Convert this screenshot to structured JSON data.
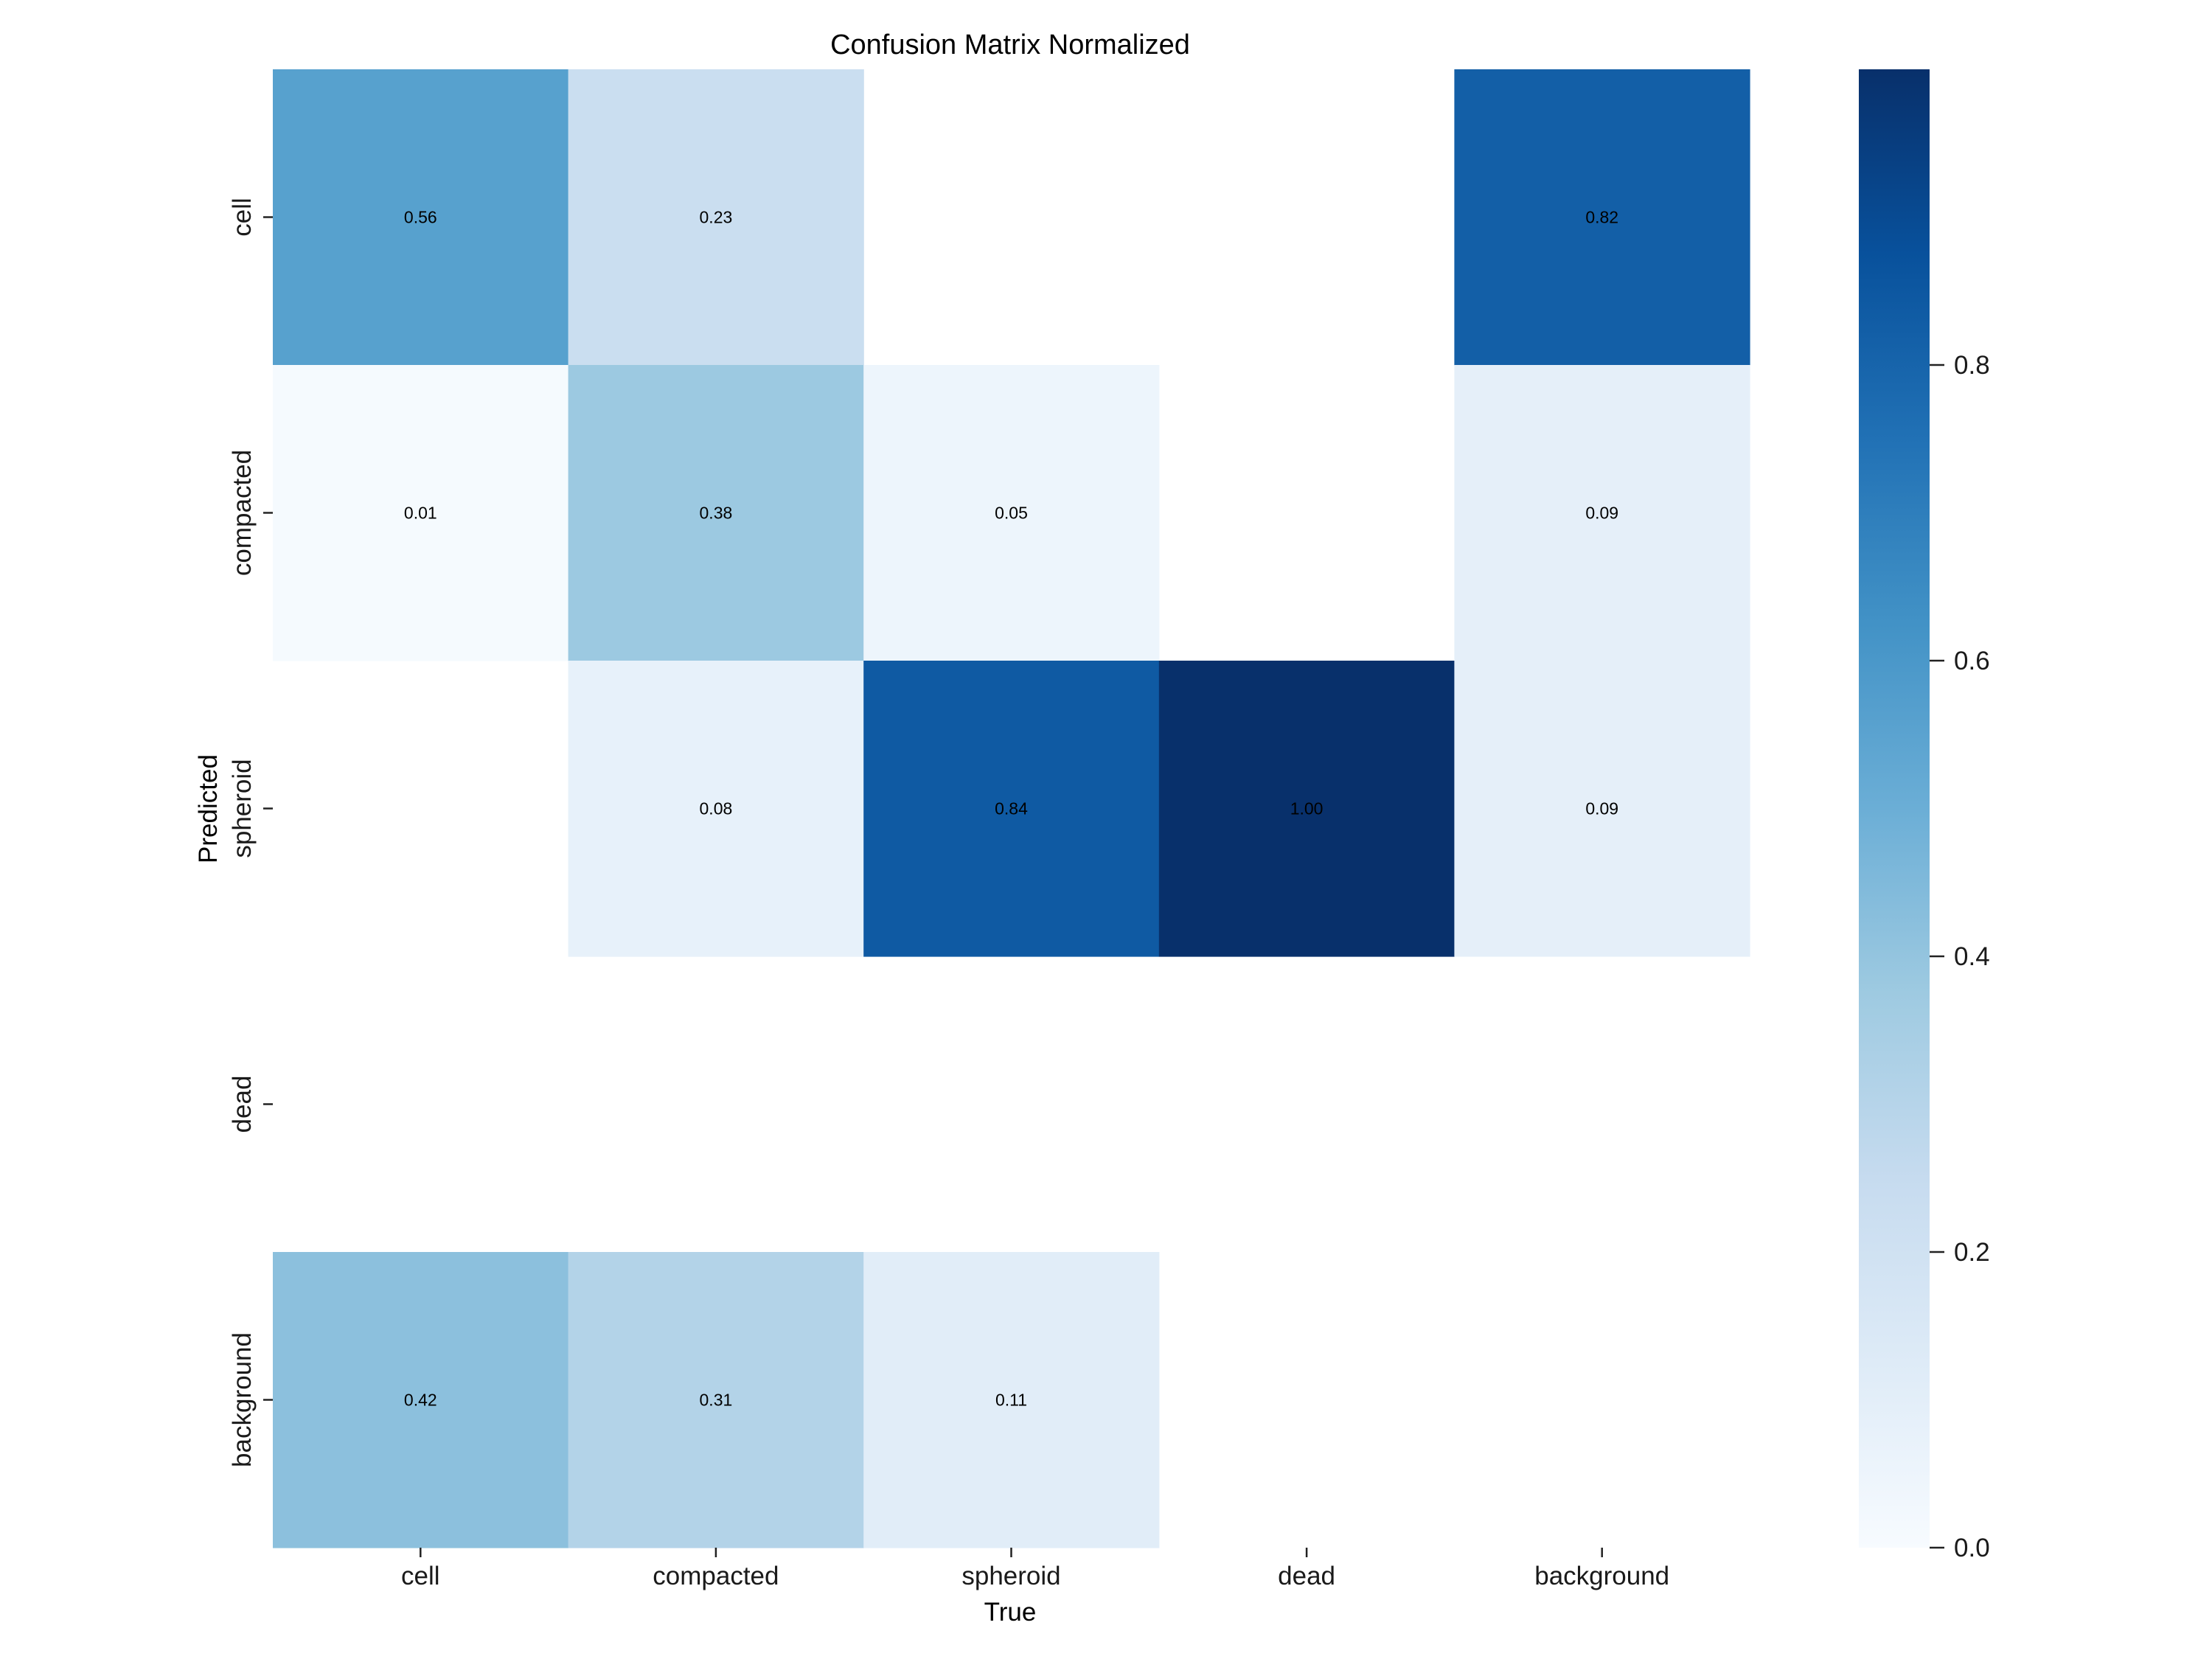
{
  "chart_data": {
    "type": "heatmap",
    "title": "Confusion Matrix Normalized",
    "xlabel": "True",
    "ylabel": "Predicted",
    "x_categories": [
      "cell",
      "compacted",
      "spheroid",
      "dead",
      "background"
    ],
    "y_categories": [
      "cell",
      "compacted",
      "spheroid",
      "dead",
      "background"
    ],
    "values": [
      [
        0.56,
        0.23,
        null,
        null,
        0.82
      ],
      [
        0.01,
        0.38,
        0.05,
        null,
        0.09
      ],
      [
        null,
        0.08,
        0.84,
        1.0,
        0.09
      ],
      [
        null,
        null,
        null,
        null,
        null
      ],
      [
        0.42,
        0.31,
        0.11,
        null,
        null
      ]
    ],
    "annotations": [
      [
        "0.56",
        "0.23",
        "",
        "",
        "0.82"
      ],
      [
        "0.01",
        "0.38",
        "0.05",
        "",
        "0.09"
      ],
      [
        "",
        "0.08",
        "0.84",
        "1.00",
        "0.09"
      ],
      [
        "",
        "",
        "",
        "",
        ""
      ],
      [
        "0.42",
        "0.31",
        "0.11",
        "",
        ""
      ]
    ],
    "colormap": "Blues",
    "vmin": 0.0,
    "vmax": 1.0,
    "colorbar": {
      "ticks": [
        0.0,
        0.2,
        0.4,
        0.6,
        0.8
      ],
      "tick_labels": [
        "0.0",
        "0.2",
        "0.4",
        "0.6",
        "0.8"
      ],
      "placement": "right"
    },
    "grid": false,
    "empty_cells_note": "cells with no value are blank (white)"
  },
  "colors": {
    "text_dark": "#262626",
    "text_light": "#ffffff",
    "blues_stops": [
      "#f7fbff",
      "#deebf7",
      "#c6dbef",
      "#9ecae1",
      "#6baed6",
      "#4292c6",
      "#2171b5",
      "#08519c",
      "#08306b"
    ]
  }
}
